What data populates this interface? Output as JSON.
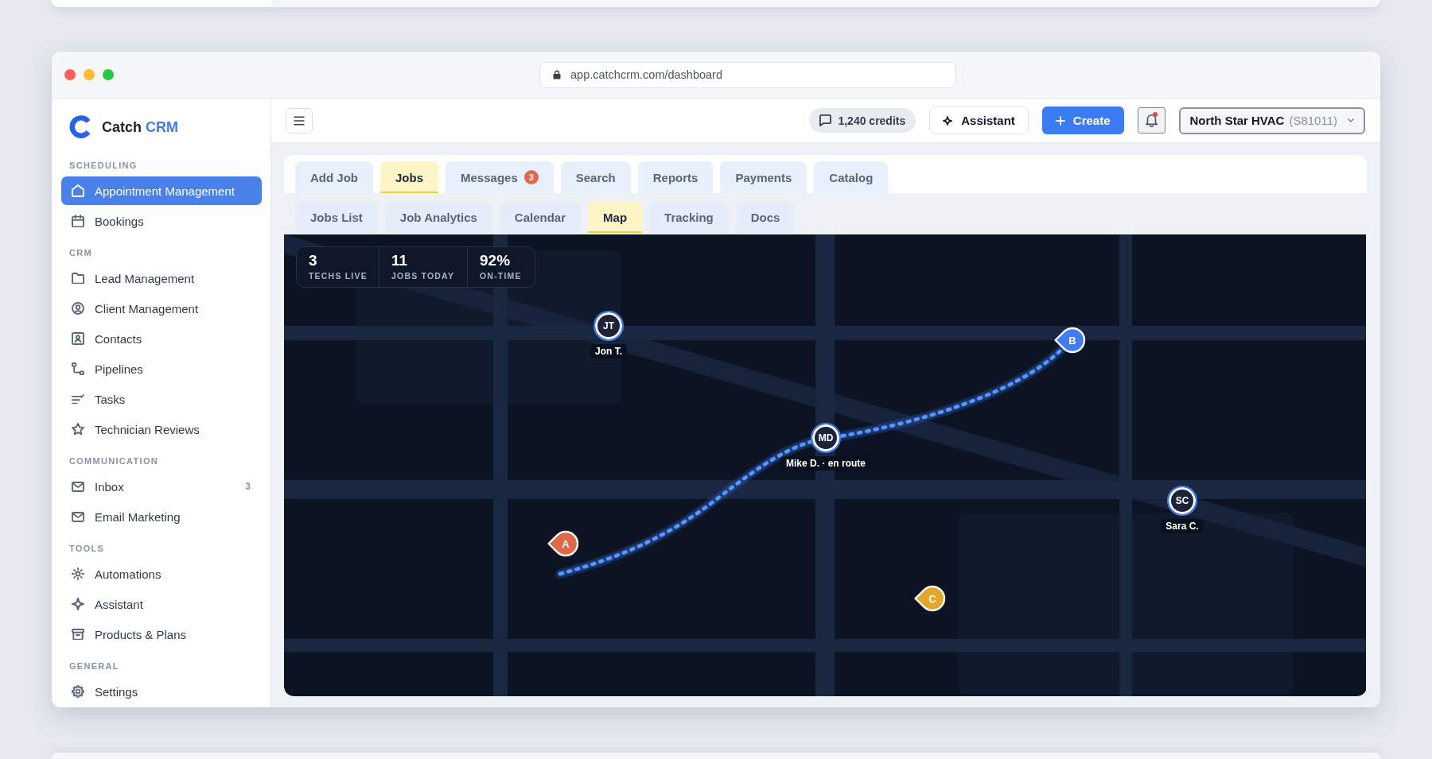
{
  "browser": {
    "url": "app.catchcrm.com/dashboard"
  },
  "sidebar": {
    "brand": {
      "name": "Catch",
      "accent": "CRM"
    },
    "sections": [
      {
        "title": "SCHEDULING",
        "items": [
          {
            "label": "Appointment Management",
            "selected": true
          },
          {
            "label": "Bookings",
            "selected": false
          }
        ]
      },
      {
        "title": "CRM",
        "items": [
          {
            "label": "Lead Management",
            "selected": false
          },
          {
            "label": "Client Management",
            "selected": false
          },
          {
            "label": "Contacts",
            "selected": false
          },
          {
            "label": "Pipelines",
            "selected": false
          },
          {
            "label": "Tasks",
            "selected": false
          },
          {
            "label": "Technician Reviews",
            "selected": false
          }
        ]
      },
      {
        "title": "COMMUNICATION",
        "items": [
          {
            "label": "Inbox",
            "count": "3",
            "selected": false
          },
          {
            "label": "Email Marketing",
            "selected": false
          }
        ]
      },
      {
        "title": "TOOLS",
        "items": [
          {
            "label": "Automations",
            "selected": false
          },
          {
            "label": "Assistant",
            "selected": false
          },
          {
            "label": "Products & Plans",
            "selected": false
          }
        ]
      },
      {
        "title": "GENERAL",
        "items": [
          {
            "label": "Settings",
            "selected": false
          }
        ]
      }
    ]
  },
  "header": {
    "credits": "1,240 credits",
    "assistant_button": "Assistant",
    "create_button": "Create",
    "notifications": {
      "unread": true
    },
    "account": {
      "name": "North Star HVAC",
      "code": "(S81011)"
    }
  },
  "tabs": [
    {
      "label": "Add Job",
      "selected": false
    },
    {
      "label": "Jobs",
      "selected": true
    },
    {
      "label": "Messages",
      "badge": "3",
      "selected": false
    },
    {
      "label": "Search",
      "selected": false
    },
    {
      "label": "Reports",
      "selected": false
    },
    {
      "label": "Payments",
      "selected": false
    },
    {
      "label": "Catalog",
      "selected": false
    }
  ],
  "subtabs": [
    {
      "label": "Jobs List",
      "selected": false
    },
    {
      "label": "Job Analytics",
      "selected": false
    },
    {
      "label": "Calendar",
      "selected": false
    },
    {
      "label": "Map",
      "selected": true
    },
    {
      "label": "Tracking",
      "selected": false
    },
    {
      "label": "Docs",
      "selected": false
    }
  ],
  "map": {
    "stats": [
      {
        "value": "3",
        "label": "TECHS LIVE"
      },
      {
        "value": "11",
        "label": "JOBS TODAY"
      },
      {
        "value": "92%",
        "label": "ON-TIME"
      }
    ],
    "technicians": [
      {
        "initials": "JT",
        "label": "Jon T."
      },
      {
        "initials": "MD",
        "label": "Mike D. · en route"
      },
      {
        "initials": "SC",
        "label": "Sara C."
      }
    ],
    "jobs": [
      {
        "label": "A",
        "color": "#e0674a"
      },
      {
        "label": "B",
        "color": "#3e7ef2"
      },
      {
        "label": "C",
        "color": "#e3a82b"
      }
    ]
  }
}
